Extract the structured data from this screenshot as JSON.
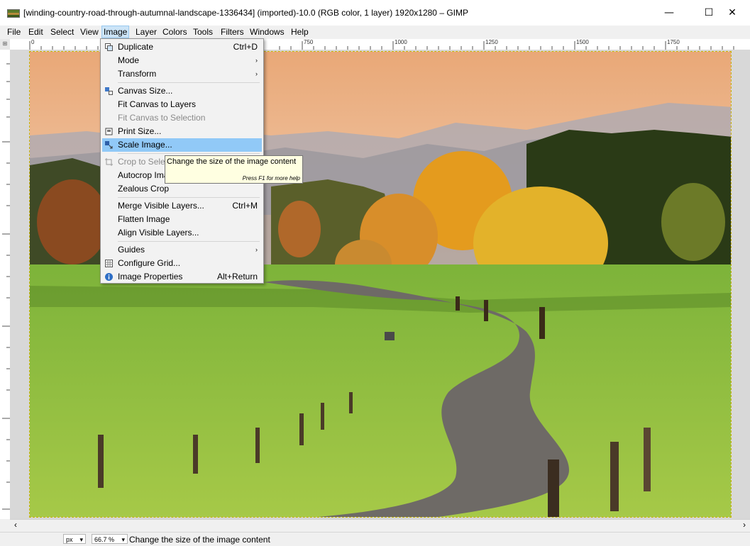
{
  "window": {
    "title": "[winding-country-road-through-autumnal-landscape-1336434] (imported)-10.0 (RGB color, 1 layer) 1920x1280 – GIMP",
    "minimize": "—",
    "maximize": "☐",
    "close": "✕"
  },
  "menubar": [
    "File",
    "Edit",
    "Select",
    "View",
    "Image",
    "Layer",
    "Colors",
    "Tools",
    "Filters",
    "Windows",
    "Help"
  ],
  "ruler": {
    "h_ticks": [
      "0",
      "750",
      "1000",
      "1250",
      "1500",
      "1750"
    ]
  },
  "image_menu": {
    "items": [
      {
        "label": "Duplicate",
        "shortcut": "Ctrl+D"
      },
      {
        "label": "Mode",
        "arrow": "›"
      },
      {
        "label": "Transform",
        "arrow": "›"
      },
      {
        "label": "Canvas Size..."
      },
      {
        "label": "Fit Canvas to Layers"
      },
      {
        "label": "Fit Canvas to Selection"
      },
      {
        "label": "Print Size..."
      },
      {
        "label": "Scale Image..."
      },
      {
        "label": "Crop to Selection"
      },
      {
        "label": "Autocrop Image"
      },
      {
        "label": "Zealous Crop"
      },
      {
        "label": "Merge Visible Layers...",
        "shortcut": "Ctrl+M"
      },
      {
        "label": "Flatten Image"
      },
      {
        "label": "Align Visible Layers..."
      },
      {
        "label": "Guides",
        "arrow": "›"
      },
      {
        "label": "Configure Grid..."
      },
      {
        "label": "Image Properties",
        "shortcut": "Alt+Return"
      }
    ]
  },
  "tooltip": {
    "text": "Change the size of the image content",
    "help": "Press F1 for more help"
  },
  "status": {
    "unit": "px",
    "zoom": "66.7 %",
    "message": "Change the size of the image content"
  },
  "scroll": {
    "left": "‹",
    "right": "›"
  },
  "colors": {
    "highlight": "#91c9f7",
    "tooltip_bg": "#ffffe1",
    "disabled": "#8a8a8a"
  }
}
